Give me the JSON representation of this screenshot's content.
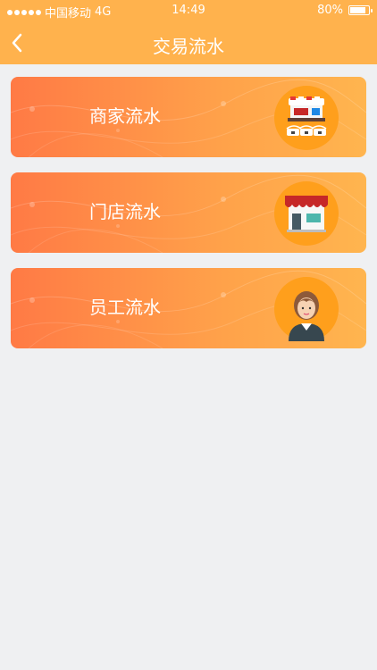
{
  "status_bar": {
    "carrier": "中国移动",
    "network": "4G",
    "time": "14:49",
    "battery": "80%"
  },
  "header": {
    "title": "交易流水",
    "back_icon": "chevron-left-icon"
  },
  "items": [
    {
      "label": "商家流水",
      "icon": "market-stall-icon"
    },
    {
      "label": "门店流水",
      "icon": "storefront-icon"
    },
    {
      "label": "员工流水",
      "icon": "employee-icon"
    }
  ],
  "colors": {
    "header_bg": "#ffb24d",
    "card_gradient_start": "#ff7a45",
    "card_gradient_end": "#ffb54f",
    "icon_circle": "#ff9f1c",
    "page_bg": "#eff0f2"
  }
}
